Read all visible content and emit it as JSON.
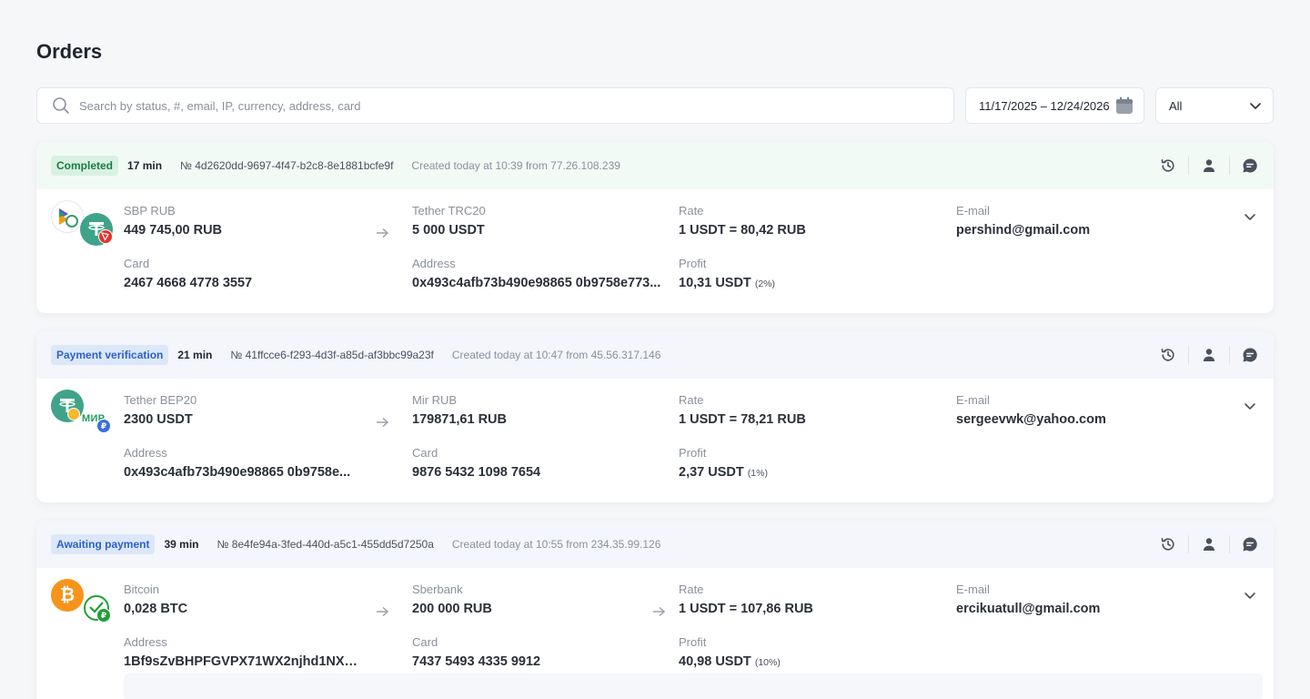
{
  "page": {
    "title": "Orders"
  },
  "toolbar": {
    "search_placeholder": "Search by status, #, email, IP, currency, address, card",
    "date_range": "11/17/2025 – 12/24/2026",
    "filter_value": "All"
  },
  "colors": {
    "completed_bg": "#dff3e7",
    "completed_fg": "#1c7a45",
    "pending_bg": "#dfe8fb",
    "pending_fg": "#2a62c9",
    "tether": "#3fa38a",
    "bitcoin": "#f7931a",
    "tron": "#e5322d"
  },
  "orders": [
    {
      "status": "Completed",
      "minutes": "17 min",
      "id": "№ 4d2620dd-9697-4f47-b2c8-8e1881bcfe9f",
      "created": "Created today at 10:39 from 77.26.108.239",
      "from_label": "SBP RUB",
      "from_value": "449 745,00 RUB",
      "from_detail_label": "Card",
      "from_detail_value": "2467 4668 4778 3557",
      "to_label": "Tether TRC20",
      "to_value": "5 000 USDT",
      "to_detail_label": "Address",
      "to_detail_value": "0x493c4afb73b490e98865 0b9758e773...",
      "rate_label": "Rate",
      "rate_value": "1 USDT = 80,42 RUB",
      "profit_label": "Profit",
      "profit_value": "10,31 USDT",
      "profit_pct": "(2%)",
      "email_label": "E-mail",
      "email_value": "pershind@gmail.com"
    },
    {
      "status": "Payment verification",
      "minutes": "21 min",
      "id": "№ 41ffcce6-f293-4d3f-a85d-af3bbc99a23f",
      "created": "Created today at 10:47 from 45.56.317.146",
      "from_label": "Tether BEP20",
      "from_value": "2300 USDT",
      "from_detail_label": "Address",
      "from_detail_value": "0x493c4afb73b490e98865 0b9758e...",
      "to_label": "Mir RUB",
      "to_value": "179871,61 RUB",
      "to_detail_label": "Card",
      "to_detail_value": "9876 5432 1098 7654",
      "rate_label": "Rate",
      "rate_value": "1 USDT = 78,21 RUB",
      "profit_label": "Profit",
      "profit_value": "2,37 USDT",
      "profit_pct": "(1%)",
      "email_label": "E-mail",
      "email_value": "sergeevwk@yahoo.com"
    },
    {
      "status": "Awaiting payment",
      "minutes": "39 min",
      "id": "№ 8e4fe94a-3fed-440d-a5c1-455dd5d7250a",
      "created": "Created today at 10:55 from 234.35.99.126",
      "from_label": "Bitcoin",
      "from_value": "0,028 BTC",
      "from_detail_label": "Address",
      "from_detail_value": "1Bf9sZvBHPFGVPX71WX2njhd1NXK...",
      "to_label": "Sberbank",
      "to_value": "200 000 RUB",
      "to_detail_label": "Card",
      "to_detail_value": "7437 5493 4335 9912",
      "rate_label": "Rate",
      "rate_value": "1 USDT = 107,86 RUB",
      "profit_label": "Profit",
      "profit_value": "40,98 USDT",
      "profit_pct": "(10%)",
      "email_label": "E-mail",
      "email_value": "ercikuatull@gmail.com"
    }
  ],
  "icons": {
    "mir_text": "МИР"
  }
}
